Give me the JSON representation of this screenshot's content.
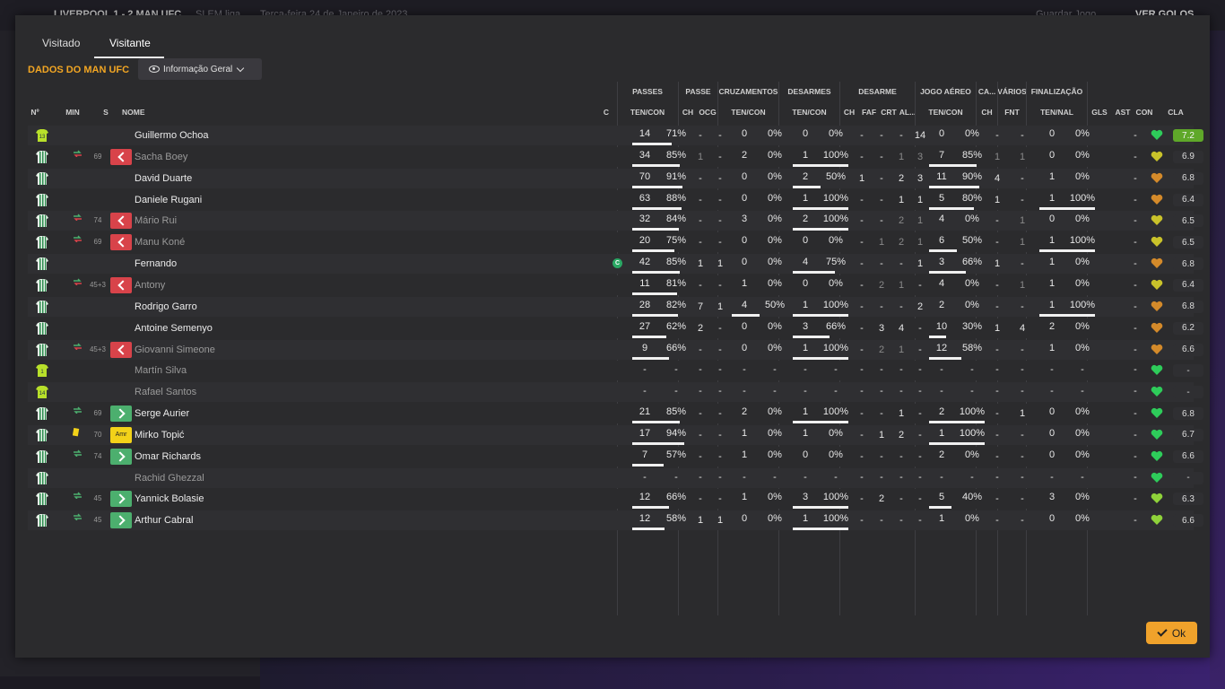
{
  "background": {
    "match_title": "LIVERPOOL 1 - 2 MAN UFC",
    "competition": "SLEM liga",
    "date": "Terça-feira 24 de Janeiro de 2023",
    "save_label": "Guardar Jogo",
    "goals_label": "VER GOLOS"
  },
  "tabs": [
    {
      "label": "Visitado"
    },
    {
      "label": "Visitante"
    }
  ],
  "section_title": "DADOS DO MAN UFC",
  "view_dropdown": {
    "label": "Informação Geral"
  },
  "groups": [
    {
      "label": "PASSES",
      "sub": "TEN/CON"
    },
    {
      "label": "PASSE",
      "sub1": "CH",
      "sub2": "OCG"
    },
    {
      "label": "CRUZAMENTOS",
      "sub": "TEN/CON"
    },
    {
      "label": "DESARMES",
      "sub": "TEN/CON"
    },
    {
      "label": "DESARME",
      "sub1": "CH",
      "sub2": "FAF",
      "sub3": "CRT",
      "sub4": "AL..."
    },
    {
      "label": "JOGO AÉREO",
      "sub": "TEN/CON"
    },
    {
      "label": "CA...",
      "sub": "CH"
    },
    {
      "label": "VÁRIOS",
      "sub": "FNT"
    },
    {
      "label": "FINALIZAÇÃO",
      "sub": "TEN/NAL"
    }
  ],
  "columns": {
    "no": "Nº",
    "min": "MIN",
    "s": "S",
    "name": "NOME",
    "c": "C",
    "gls": "GLS",
    "ast": "AST",
    "con": "CON",
    "cla": "CLA"
  },
  "captain_badge": "C",
  "players": [
    {
      "name": "Guillermo Ochoa",
      "kit": "gk",
      "kit_no": "13",
      "min": "",
      "sub": "",
      "swap": "",
      "pass": [
        "14",
        "71%"
      ],
      "pass_fill": 0.71,
      "pch": "-",
      "pocg": "-",
      "cruz": [
        "0",
        "0%"
      ],
      "cruz_fill": 0,
      "des": [
        "0",
        "0%"
      ],
      "des_fill": 0,
      "dch": "-",
      "dfaf": "-",
      "dcrt": "-",
      "dal": "14",
      "aer": [
        "0",
        "0%"
      ],
      "aer_fill": 0,
      "cach": "-",
      "fnt": "-",
      "fin": [
        "0",
        "0%"
      ],
      "fin_fill": 0,
      "gls": "",
      "ast": "-",
      "con_color": "#2ecc5a",
      "rating": "7.2",
      "best": true
    },
    {
      "name": "Sacha Boey",
      "dim": true,
      "kit": "field",
      "min": "69",
      "sub": "out",
      "swap": "red",
      "pass": [
        "34",
        "85%"
      ],
      "pass_fill": 0.85,
      "pch": "1",
      "pocg": "-",
      "cruz": [
        "2",
        "0%"
      ],
      "cruz_fill": 0,
      "des": [
        "1",
        "100%"
      ],
      "des_fill": 1,
      "dch": "-",
      "dfaf": "-",
      "dcrt": "1",
      "dal": "3",
      "aer": [
        "7",
        "85%"
      ],
      "aer_fill": 0.85,
      "cach": "1",
      "fnt": "1",
      "fin": [
        "0",
        "0%"
      ],
      "fin_fill": 0,
      "gls": "",
      "ast": "-",
      "con_color": "#c9c22a",
      "rating": "6.9"
    },
    {
      "name": "David Duarte",
      "kit": "field",
      "min": "",
      "sub": "",
      "swap": "",
      "pass": [
        "70",
        "91%"
      ],
      "pass_fill": 0.91,
      "pch": "-",
      "pocg": "-",
      "cruz": [
        "0",
        "0%"
      ],
      "cruz_fill": 0,
      "des": [
        "2",
        "50%"
      ],
      "des_fill": 0.5,
      "dch": "1",
      "dfaf": "-",
      "dcrt": "2",
      "dal": "3",
      "aer": [
        "11",
        "90%"
      ],
      "aer_fill": 0.9,
      "cach": "4",
      "fnt": "-",
      "fin": [
        "1",
        "0%"
      ],
      "fin_fill": 0,
      "gls": "",
      "ast": "-",
      "con_color": "#d48a2a",
      "rating": "6.8"
    },
    {
      "name": "Daniele Rugani",
      "kit": "field",
      "min": "",
      "sub": "",
      "swap": "",
      "pass": [
        "63",
        "88%"
      ],
      "pass_fill": 0.88,
      "pch": "-",
      "pocg": "-",
      "cruz": [
        "0",
        "0%"
      ],
      "cruz_fill": 0,
      "des": [
        "1",
        "100%"
      ],
      "des_fill": 1,
      "dch": "-",
      "dfaf": "-",
      "dcrt": "1",
      "dal": "1",
      "aer": [
        "5",
        "80%"
      ],
      "aer_fill": 0.8,
      "cach": "1",
      "fnt": "-",
      "fin": [
        "1",
        "100%"
      ],
      "fin_fill": 1,
      "gls": "",
      "ast": "-",
      "con_color": "#d48a2a",
      "rating": "6.4"
    },
    {
      "name": "Mário Rui",
      "dim": true,
      "kit": "field",
      "min": "74",
      "sub": "out",
      "swap": "red",
      "pass": [
        "32",
        "84%"
      ],
      "pass_fill": 0.84,
      "pch": "-",
      "pocg": "-",
      "cruz": [
        "3",
        "0%"
      ],
      "cruz_fill": 0,
      "des": [
        "2",
        "100%"
      ],
      "des_fill": 1,
      "dch": "-",
      "dfaf": "-",
      "dcrt": "2",
      "dal": "1",
      "aer": [
        "4",
        "0%"
      ],
      "aer_fill": 0,
      "cach": "-",
      "fnt": "1",
      "fin": [
        "0",
        "0%"
      ],
      "fin_fill": 0,
      "gls": "",
      "ast": "-",
      "con_color": "#c9c22a",
      "rating": "6.5"
    },
    {
      "name": "Manu Koné",
      "dim": true,
      "kit": "field",
      "min": "69",
      "sub": "out",
      "swap": "red",
      "pass": [
        "20",
        "75%"
      ],
      "pass_fill": 0.75,
      "pch": "-",
      "pocg": "-",
      "cruz": [
        "0",
        "0%"
      ],
      "cruz_fill": 0,
      "des": [
        "0",
        "0%"
      ],
      "des_fill": 0,
      "dch": "-",
      "dfaf": "1",
      "dcrt": "2",
      "dal": "1",
      "aer": [
        "6",
        "50%"
      ],
      "aer_fill": 0.5,
      "cach": "-",
      "fnt": "1",
      "fin": [
        "1",
        "100%"
      ],
      "fin_fill": 1,
      "gls": "",
      "ast": "-",
      "con_color": "#c9c22a",
      "rating": "6.5"
    },
    {
      "name": "Fernando",
      "kit": "field",
      "captain": true,
      "min": "",
      "sub": "",
      "swap": "",
      "pass": [
        "42",
        "85%"
      ],
      "pass_fill": 0.85,
      "pch": "1",
      "pocg": "1",
      "cruz": [
        "0",
        "0%"
      ],
      "cruz_fill": 0,
      "des": [
        "4",
        "75%"
      ],
      "des_fill": 0.75,
      "dch": "-",
      "dfaf": "-",
      "dcrt": "-",
      "dal": "1",
      "aer": [
        "3",
        "66%"
      ],
      "aer_fill": 0.66,
      "cach": "1",
      "fnt": "-",
      "fin": [
        "1",
        "0%"
      ],
      "fin_fill": 0,
      "gls": "",
      "ast": "-",
      "con_color": "#d48a2a",
      "rating": "6.8"
    },
    {
      "name": "Antony",
      "dim": true,
      "kit": "field",
      "min": "45+3",
      "sub": "out",
      "swap": "red",
      "pass": [
        "11",
        "81%"
      ],
      "pass_fill": 0.81,
      "pch": "-",
      "pocg": "-",
      "cruz": [
        "1",
        "0%"
      ],
      "cruz_fill": 0,
      "des": [
        "0",
        "0%"
      ],
      "des_fill": 0,
      "dch": "-",
      "dfaf": "2",
      "dcrt": "1",
      "dal": "-",
      "aer": [
        "4",
        "0%"
      ],
      "aer_fill": 0,
      "cach": "-",
      "fnt": "1",
      "fin": [
        "1",
        "0%"
      ],
      "fin_fill": 0,
      "gls": "",
      "ast": "-",
      "con_color": "#c9c22a",
      "rating": "6.4"
    },
    {
      "name": "Rodrigo Garro",
      "kit": "field",
      "min": "",
      "sub": "",
      "swap": "",
      "pass": [
        "28",
        "82%"
      ],
      "pass_fill": 0.82,
      "pch": "7",
      "pocg": "1",
      "cruz": [
        "4",
        "50%"
      ],
      "cruz_fill": 0.5,
      "des": [
        "1",
        "100%"
      ],
      "des_fill": 1,
      "dch": "-",
      "dfaf": "-",
      "dcrt": "-",
      "dal": "2",
      "aer": [
        "2",
        "0%"
      ],
      "aer_fill": 0,
      "cach": "-",
      "fnt": "-",
      "fin": [
        "1",
        "100%"
      ],
      "fin_fill": 1,
      "gls": "",
      "ast": "-",
      "con_color": "#d48a2a",
      "rating": "6.8"
    },
    {
      "name": "Antoine Semenyo",
      "kit": "field",
      "min": "",
      "sub": "",
      "swap": "",
      "pass": [
        "27",
        "62%"
      ],
      "pass_fill": 0.62,
      "pch": "2",
      "pocg": "-",
      "cruz": [
        "0",
        "0%"
      ],
      "cruz_fill": 0,
      "des": [
        "3",
        "66%"
      ],
      "des_fill": 0.66,
      "dch": "-",
      "dfaf": "3",
      "dcrt": "4",
      "dal": "-",
      "aer": [
        "10",
        "30%"
      ],
      "aer_fill": 0.3,
      "cach": "1",
      "fnt": "4",
      "fin": [
        "2",
        "0%"
      ],
      "fin_fill": 0,
      "gls": "",
      "ast": "-",
      "con_color": "#d48a2a",
      "rating": "6.2"
    },
    {
      "name": "Giovanni Simeone",
      "dim": true,
      "kit": "field",
      "min": "45+3",
      "sub": "out",
      "swap": "red",
      "pass": [
        "9",
        "66%"
      ],
      "pass_fill": 0.66,
      "pch": "-",
      "pocg": "-",
      "cruz": [
        "0",
        "0%"
      ],
      "cruz_fill": 0,
      "des": [
        "1",
        "100%"
      ],
      "des_fill": 1,
      "dch": "-",
      "dfaf": "2",
      "dcrt": "1",
      "dal": "-",
      "aer": [
        "12",
        "58%"
      ],
      "aer_fill": 0.58,
      "cach": "-",
      "fnt": "-",
      "fin": [
        "1",
        "0%"
      ],
      "fin_fill": 0,
      "gls": "",
      "ast": "-",
      "con_color": "#d48a2a",
      "rating": "6.6"
    },
    {
      "name": "Martín Silva",
      "dim": true,
      "kit": "gk",
      "kit_no": "1",
      "min": "",
      "sub": "",
      "swap": "",
      "empty": true,
      "con_color": "#2ecc5a",
      "rating": "-"
    },
    {
      "name": "Rafael Santos",
      "dim": true,
      "kit": "gk",
      "kit_no": "14",
      "min": "",
      "sub": "",
      "swap": "",
      "empty": true,
      "con_color": "#2ecc5a",
      "rating": "-"
    },
    {
      "name": "Serge Aurier",
      "kit": "field",
      "min": "69",
      "sub": "in",
      "swap": "green",
      "pass": [
        "21",
        "85%"
      ],
      "pass_fill": 0.85,
      "pch": "-",
      "pocg": "-",
      "cruz": [
        "2",
        "0%"
      ],
      "cruz_fill": 0,
      "des": [
        "1",
        "100%"
      ],
      "des_fill": 1,
      "dch": "-",
      "dfaf": "-",
      "dcrt": "1",
      "dal": "-",
      "aer": [
        "2",
        "100%"
      ],
      "aer_fill": 1,
      "cach": "-",
      "fnt": "1",
      "fin": [
        "0",
        "0%"
      ],
      "fin_fill": 0,
      "gls": "",
      "ast": "-",
      "con_color": "#2ecc5a",
      "rating": "6.8"
    },
    {
      "name": "Mirko Topić",
      "kit": "field",
      "min": "70",
      "sub": "yel",
      "sub_label": "Amr",
      "swap": "yellow",
      "pass": [
        "17",
        "94%"
      ],
      "pass_fill": 0.94,
      "pch": "-",
      "pocg": "-",
      "cruz": [
        "1",
        "0%"
      ],
      "cruz_fill": 0,
      "des": [
        "1",
        "0%"
      ],
      "des_fill": 0,
      "dch": "-",
      "dfaf": "1",
      "dcrt": "2",
      "dal": "-",
      "aer": [
        "1",
        "100%"
      ],
      "aer_fill": 1,
      "cach": "-",
      "fnt": "-",
      "fin": [
        "0",
        "0%"
      ],
      "fin_fill": 0,
      "gls": "",
      "ast": "-",
      "con_color": "#2ecc5a",
      "rating": "6.7"
    },
    {
      "name": "Omar Richards",
      "kit": "field",
      "min": "74",
      "sub": "in",
      "swap": "green",
      "pass": [
        "7",
        "57%"
      ],
      "pass_fill": 0.57,
      "pch": "-",
      "pocg": "-",
      "cruz": [
        "1",
        "0%"
      ],
      "cruz_fill": 0,
      "des": [
        "0",
        "0%"
      ],
      "des_fill": 0,
      "dch": "-",
      "dfaf": "-",
      "dcrt": "-",
      "dal": "-",
      "aer": [
        "2",
        "0%"
      ],
      "aer_fill": 0,
      "cach": "-",
      "fnt": "-",
      "fin": [
        "0",
        "0%"
      ],
      "fin_fill": 0,
      "gls": "",
      "ast": "-",
      "con_color": "#2ecc5a",
      "rating": "6.6"
    },
    {
      "name": "Rachid Ghezzal",
      "dim": true,
      "kit": "field",
      "min": "",
      "sub": "",
      "swap": "",
      "empty": true,
      "con_color": "#2ecc5a",
      "rating": "-"
    },
    {
      "name": "Yannick Bolasie",
      "kit": "field",
      "min": "45",
      "sub": "in",
      "swap": "green",
      "pass": [
        "12",
        "66%"
      ],
      "pass_fill": 0.66,
      "pch": "-",
      "pocg": "-",
      "cruz": [
        "1",
        "0%"
      ],
      "cruz_fill": 0,
      "des": [
        "3",
        "100%"
      ],
      "des_fill": 1,
      "dch": "-",
      "dfaf": "2",
      "dcrt": "-",
      "dal": "-",
      "aer": [
        "5",
        "40%"
      ],
      "aer_fill": 0.4,
      "cach": "-",
      "fnt": "-",
      "fin": [
        "3",
        "0%"
      ],
      "fin_fill": 0,
      "gls": "",
      "ast": "-",
      "con_color": "#8fd23a",
      "rating": "6.3"
    },
    {
      "name": "Arthur Cabral",
      "kit": "field",
      "min": "45",
      "sub": "in",
      "swap": "green",
      "pass": [
        "12",
        "58%"
      ],
      "pass_fill": 0.58,
      "pch": "1",
      "pocg": "1",
      "cruz": [
        "0",
        "0%"
      ],
      "cruz_fill": 0,
      "des": [
        "1",
        "100%"
      ],
      "des_fill": 1,
      "dch": "-",
      "dfaf": "-",
      "dcrt": "-",
      "dal": "-",
      "aer": [
        "1",
        "0%"
      ],
      "aer_fill": 0,
      "cach": "-",
      "fnt": "-",
      "fin": [
        "0",
        "0%"
      ],
      "fin_fill": 0,
      "gls": "",
      "ast": "-",
      "con_color": "#8fd23a",
      "rating": "6.6"
    }
  ],
  "ok_label": "Ok"
}
